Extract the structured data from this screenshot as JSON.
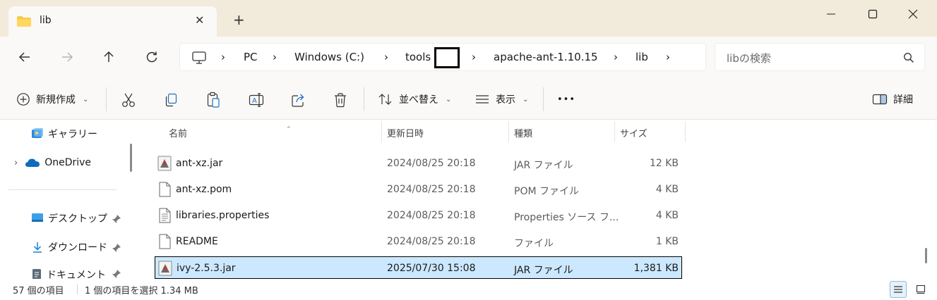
{
  "tab": {
    "title": "lib",
    "close": "✕",
    "new_tab": "+"
  },
  "address": {
    "segments": [
      "PC",
      "Windows (C:)",
      "tools",
      "apache-ant-1.10.15",
      "lib"
    ],
    "chevron": "›"
  },
  "search": {
    "placeholder": "libの検索"
  },
  "toolbar": {
    "new_label": "新規作成",
    "sort_label": "並べ替え",
    "view_label": "表示",
    "more_label": "•••",
    "details_label": "詳細"
  },
  "nav": {
    "gallery": "ギャラリー",
    "onedrive": "OneDrive",
    "desktop": "デスクトップ",
    "downloads": "ダウンロード",
    "documents": "ドキュメント"
  },
  "columns": {
    "name": "名前",
    "date": "更新日時",
    "type": "種類",
    "size": "サイズ"
  },
  "files": [
    {
      "name": "ant-xz.jar",
      "date": "2024/08/25 20:18",
      "type": "JAR ファイル",
      "size": "12 KB",
      "icon": "jar-file-icon"
    },
    {
      "name": "ant-xz.pom",
      "date": "2024/08/25 20:18",
      "type": "POM ファイル",
      "size": "4 KB",
      "icon": "blank-file-icon"
    },
    {
      "name": "libraries.properties",
      "date": "2024/08/25 20:18",
      "type": "Properties ソース フ...",
      "size": "4 KB",
      "icon": "text-file-icon"
    },
    {
      "name": "README",
      "date": "2024/08/25 20:18",
      "type": "ファイル",
      "size": "1 KB",
      "icon": "blank-file-icon"
    },
    {
      "name": "ivy-2.5.3.jar",
      "date": "2025/07/30 15:08",
      "type": "JAR ファイル",
      "size": "1,381 KB",
      "icon": "jar-file-icon",
      "selected": true
    }
  ],
  "status": {
    "item_count": "57 個の項目",
    "selection": "1 個の項目を選択  1.34 MB"
  },
  "colors": {
    "titlebar": "#f2eadb",
    "selection": "#cce8ff",
    "accent": "#0067c0"
  }
}
